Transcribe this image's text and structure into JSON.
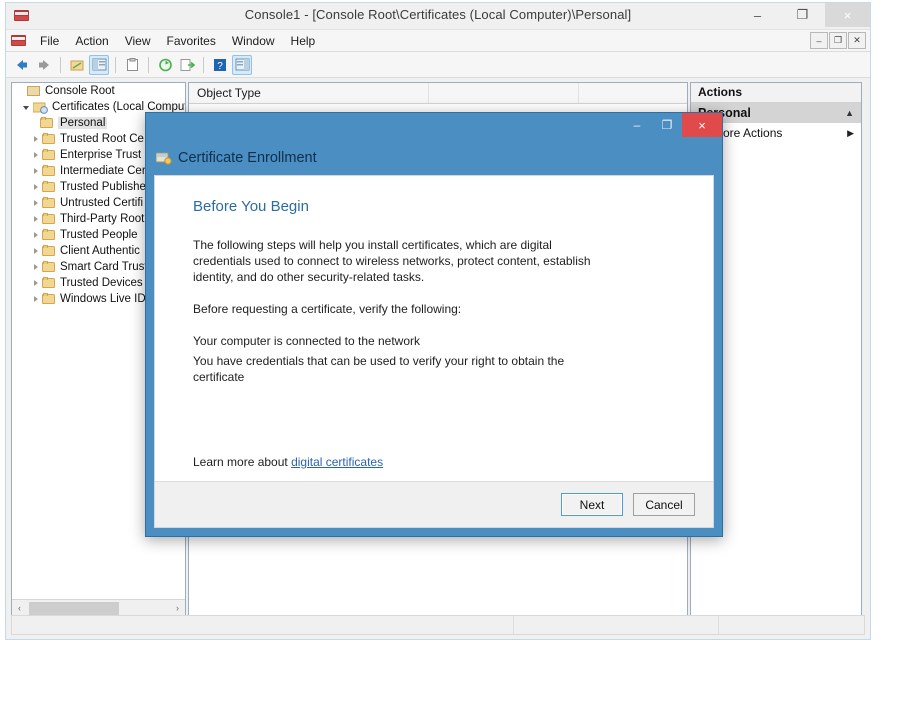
{
  "window": {
    "title": "Console1 - [Console Root\\Certificates (Local Computer)\\Personal]",
    "icon": "mmc-console-icon",
    "controls": {
      "minimize": "–",
      "maximize": "❐",
      "close": "×"
    },
    "mdi_controls": {
      "minimize": "–",
      "restore": "❐",
      "close": "✕"
    }
  },
  "menubar": {
    "icon": "mmc-console-icon",
    "items": [
      {
        "label": "File"
      },
      {
        "label": "Action"
      },
      {
        "label": "View"
      },
      {
        "label": "Favorites"
      },
      {
        "label": "Window"
      },
      {
        "label": "Help"
      }
    ]
  },
  "toolbar": {
    "buttons": [
      {
        "name": "back-icon",
        "glyph": "←",
        "color": "#2f7ec4",
        "selected": false
      },
      {
        "name": "forward-icon",
        "glyph": "→",
        "color": "#8a8a8a",
        "selected": false
      },
      {
        "name": "up-folder-icon",
        "glyph": "▰",
        "color": "#e0b64a",
        "selected": false
      },
      {
        "name": "show-hide-tree-icon",
        "glyph": "▤",
        "color": "#6fa5cf",
        "selected": true
      },
      {
        "name": "properties-icon",
        "glyph": "▯",
        "color": "#9a9a9a",
        "selected": false
      },
      {
        "name": "refresh-icon",
        "glyph": "↻",
        "color": "#4caf50",
        "selected": false
      },
      {
        "name": "export-list-icon",
        "glyph": "⇨",
        "color": "#4caf50",
        "selected": false
      },
      {
        "name": "help-icon",
        "glyph": "?",
        "color": "#1f64b0",
        "selected": false
      },
      {
        "name": "show-action-pane-icon",
        "glyph": "▥",
        "color": "#6fa5cf",
        "selected": true
      }
    ]
  },
  "tree": {
    "items": [
      {
        "label": "Console Root",
        "depth": 0,
        "expander": "none",
        "icon": "console-root-icon",
        "selected": false
      },
      {
        "label": "Certificates (Local Compute",
        "depth": 1,
        "expander": "open",
        "icon": "certificates-store-icon",
        "selected": false
      },
      {
        "label": "Personal",
        "depth": 2,
        "expander": "none",
        "icon": "folder-icon",
        "selected": true
      },
      {
        "label": "Trusted Root Ce",
        "depth": 2,
        "expander": "closed",
        "icon": "folder-icon",
        "selected": false
      },
      {
        "label": "Enterprise Trust",
        "depth": 2,
        "expander": "closed",
        "icon": "folder-icon",
        "selected": false
      },
      {
        "label": "Intermediate Cer",
        "depth": 2,
        "expander": "closed",
        "icon": "folder-icon",
        "selected": false
      },
      {
        "label": "Trusted Publishe",
        "depth": 2,
        "expander": "closed",
        "icon": "folder-icon",
        "selected": false
      },
      {
        "label": "Untrusted Certifi",
        "depth": 2,
        "expander": "closed",
        "icon": "folder-icon",
        "selected": false
      },
      {
        "label": "Third-Party Root",
        "depth": 2,
        "expander": "closed",
        "icon": "folder-icon",
        "selected": false
      },
      {
        "label": "Trusted People",
        "depth": 2,
        "expander": "closed",
        "icon": "folder-icon",
        "selected": false
      },
      {
        "label": "Client Authentic",
        "depth": 2,
        "expander": "closed",
        "icon": "folder-icon",
        "selected": false
      },
      {
        "label": "Smart Card Trust",
        "depth": 2,
        "expander": "closed",
        "icon": "folder-icon",
        "selected": false
      },
      {
        "label": "Trusted Devices",
        "depth": 2,
        "expander": "closed",
        "icon": "folder-icon",
        "selected": false
      },
      {
        "label": "Windows Live ID",
        "depth": 2,
        "expander": "closed",
        "icon": "folder-icon",
        "selected": false
      }
    ],
    "hscroll": {
      "left_arrow": "‹",
      "right_arrow": "›"
    }
  },
  "list": {
    "columns": [
      {
        "label": "Object Type"
      },
      {
        "label": ""
      }
    ],
    "rows": []
  },
  "actions": {
    "header": "Actions",
    "section": {
      "label": "Personal",
      "caret": "▲"
    },
    "items": [
      {
        "label": "More Actions",
        "arrow": "▶"
      }
    ]
  },
  "dialog": {
    "icon": "certificate-enrollment-icon",
    "title": "Certificate Enrollment",
    "controls": {
      "minimize": "–",
      "maximize": "❐",
      "close": "×"
    },
    "heading": "Before You Begin",
    "paragraphs": [
      "The following steps will help you install certificates, which are digital credentials used to connect to wireless networks, protect content, establish identity, and do other security-related tasks.",
      "Before requesting a certificate, verify the following:"
    ],
    "checklist": [
      "Your computer is connected to the network",
      "You have credentials that can be used to verify your right to obtain the certificate"
    ],
    "learn_more_prefix": "Learn more about ",
    "learn_more_link": "digital certificates",
    "buttons": {
      "next": "Next",
      "cancel": "Cancel"
    },
    "accent_color": "#4a8ec2",
    "heading_color": "#2b6ca3",
    "close_color": "#e04a4a"
  }
}
